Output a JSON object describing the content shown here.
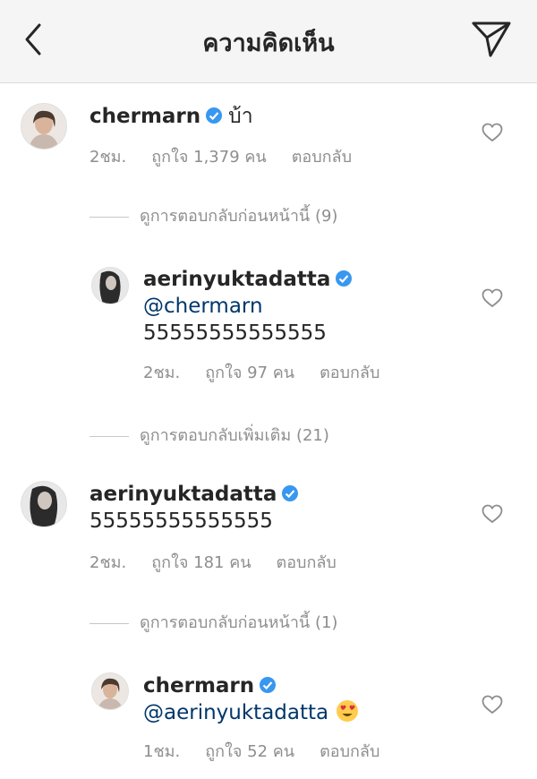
{
  "header": {
    "title": "ความคิดเห็น",
    "back_icon": "chevron-left-icon",
    "send_icon": "paper-plane-icon"
  },
  "verified_color": "#3897f0",
  "comments": [
    {
      "username": "chermarn",
      "text": "บ้า",
      "time": "2ชม.",
      "likes": "ถูกใจ 1,379 คน",
      "reply": "ตอบกลับ",
      "view_replies": "ดูการตอบกลับก่อนหน้านี้ (9)"
    },
    {
      "username": "aerinyuktadatta",
      "mention": "@chermarn",
      "text": "55555555555555",
      "time": "2ชม.",
      "likes": "ถูกใจ 97 คน",
      "reply": "ตอบกลับ",
      "view_replies": "ดูการตอบกลับเพิ่มเติม (21)"
    },
    {
      "username": "aerinyuktadatta",
      "text": "55555555555555",
      "time": "2ชม.",
      "likes": "ถูกใจ 181 คน",
      "reply": "ตอบกลับ",
      "view_replies": "ดูการตอบกลับก่อนหน้านี้ (1)"
    },
    {
      "username": "chermarn",
      "mention": "@aerinyuktadatta",
      "emoji": "heart-eyes-emoji",
      "time": "1ชม.",
      "likes": "ถูกใจ 52 คน",
      "reply": "ตอบกลับ"
    }
  ]
}
